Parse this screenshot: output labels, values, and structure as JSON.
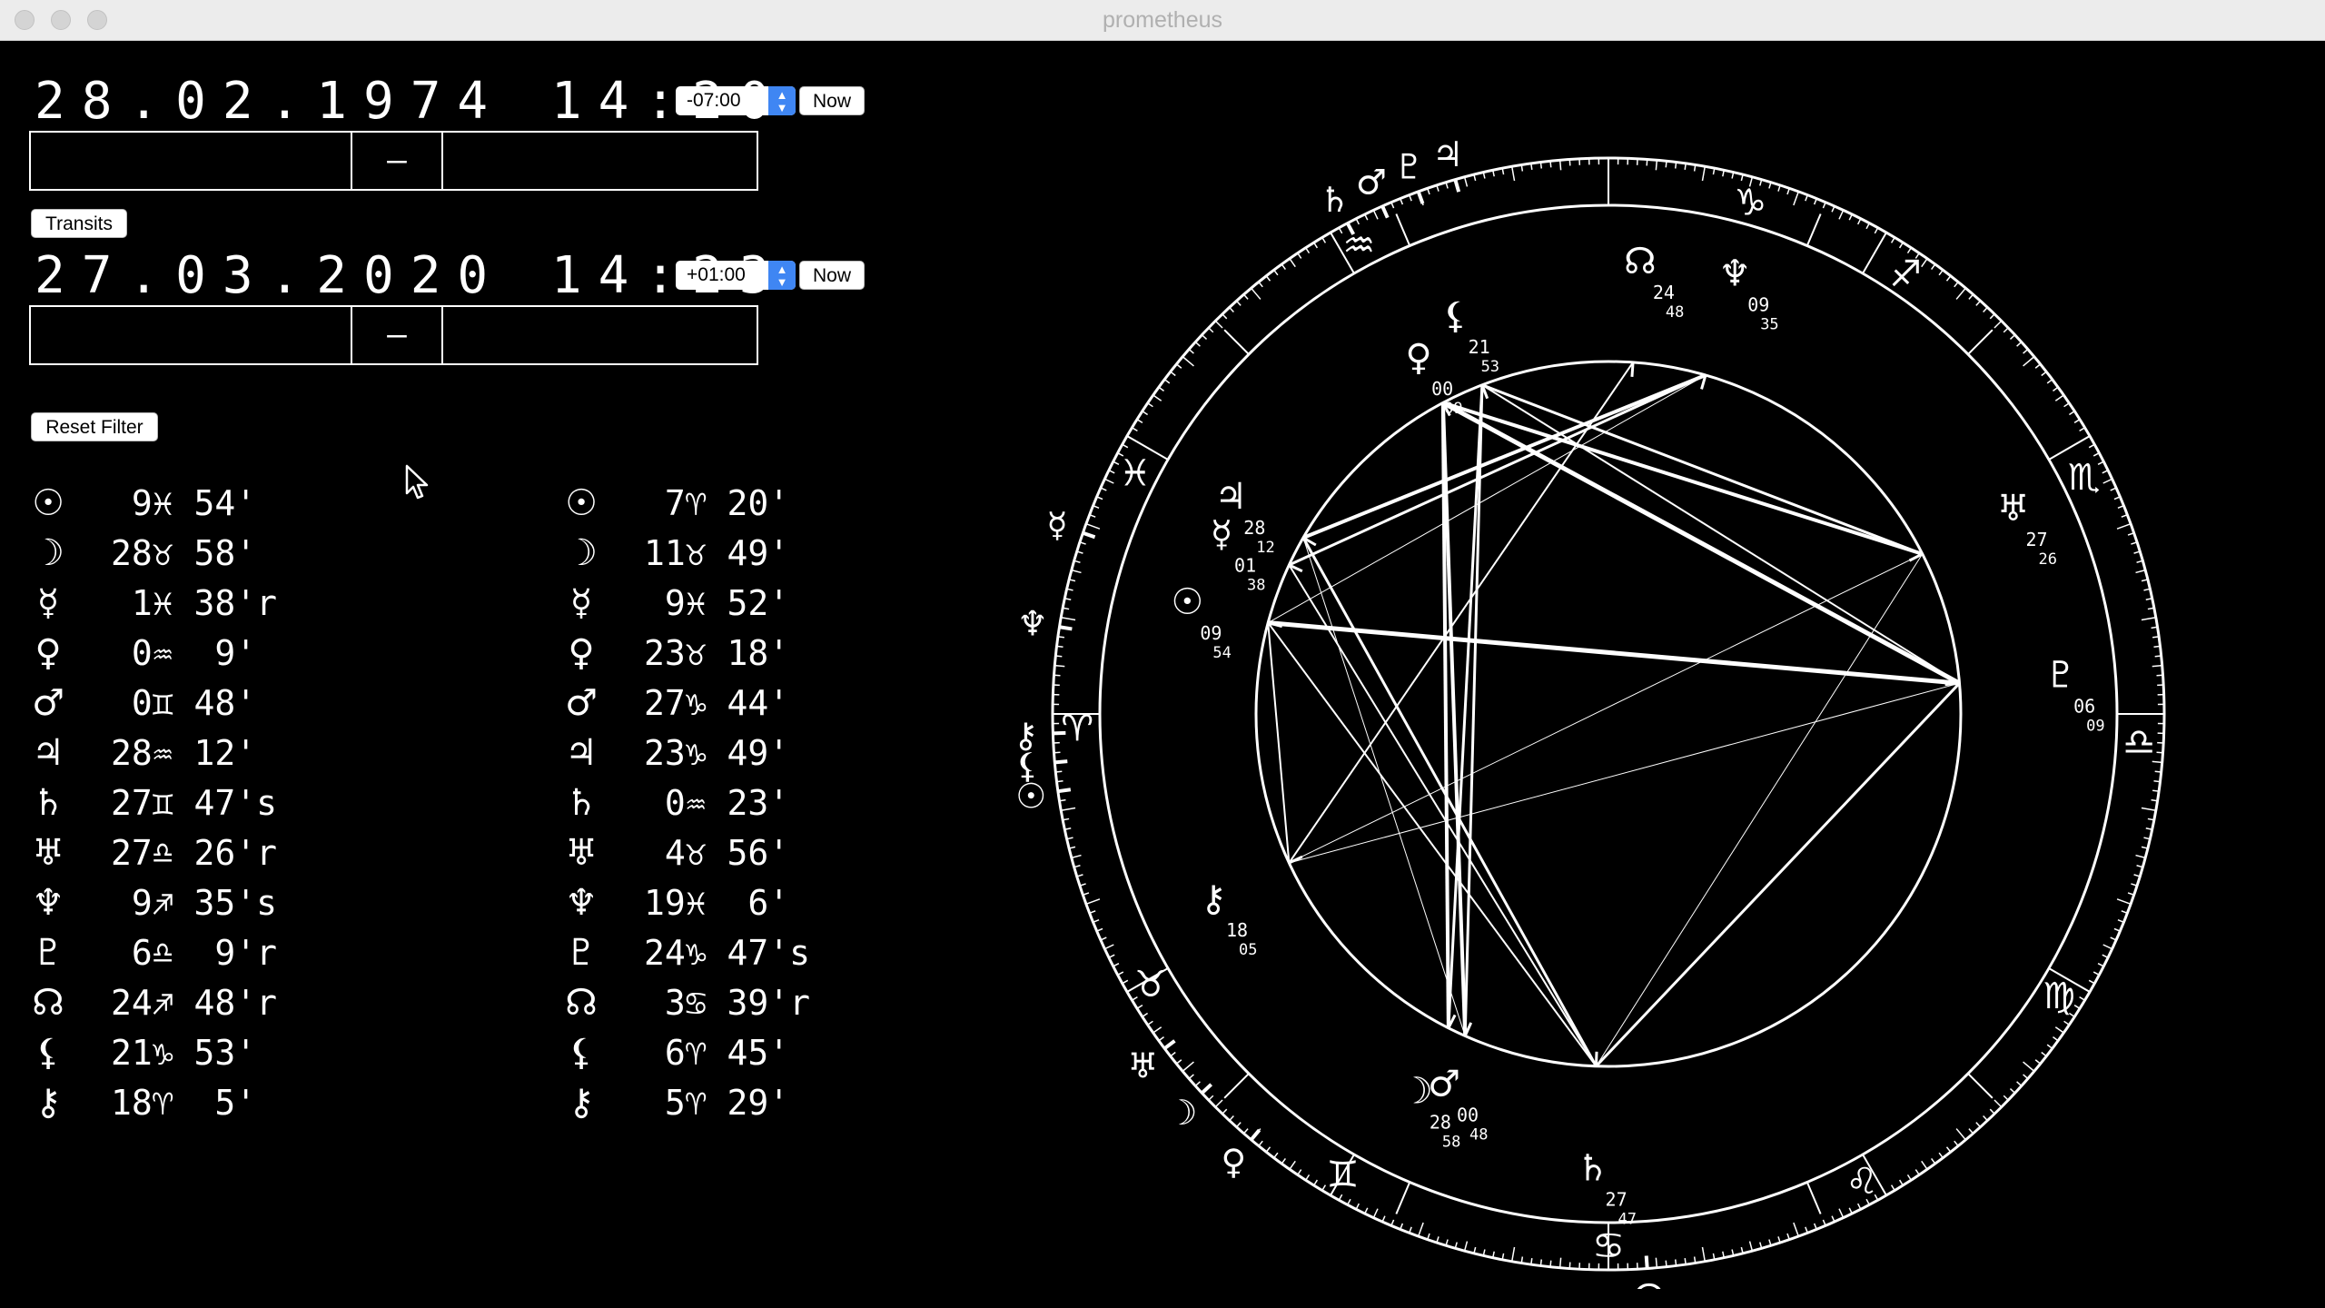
{
  "window": {
    "title": "prometheus"
  },
  "natal": {
    "datetime": "28.02.1974 14:20",
    "timezone": "-07:00",
    "now_label": "Now",
    "location_separator": "–"
  },
  "transits_label": "Transits",
  "transit": {
    "datetime": "27.03.2020 14:23",
    "timezone": "+01:00",
    "now_label": "Now",
    "location_separator": "–"
  },
  "reset_filter_label": "Reset Filter",
  "icons": {
    "stepper": "stepper-arrows-icon",
    "cursor": "mouse-pointer-icon"
  },
  "natal_positions": [
    {
      "planet": "sun",
      "glyph": "☉",
      "text": " 9♓ 54'"
    },
    {
      "planet": "moon",
      "glyph": "☽",
      "text": "28♉ 58'"
    },
    {
      "planet": "mercury",
      "glyph": "☿",
      "text": " 1♓ 38'r"
    },
    {
      "planet": "venus",
      "glyph": "♀",
      "text": " 0♒  9'"
    },
    {
      "planet": "mars",
      "glyph": "♂",
      "text": " 0♊ 48'"
    },
    {
      "planet": "jupiter",
      "glyph": "♃",
      "text": "28♒ 12'"
    },
    {
      "planet": "saturn",
      "glyph": "♄",
      "text": "27♊ 47's"
    },
    {
      "planet": "uranus",
      "glyph": "♅",
      "text": "27♎ 26'r"
    },
    {
      "planet": "neptune",
      "glyph": "♆",
      "text": " 9♐ 35's"
    },
    {
      "planet": "pluto",
      "glyph": "♇",
      "text": " 6♎  9'r"
    },
    {
      "planet": "node",
      "glyph": "☊",
      "text": "24♐ 48'r"
    },
    {
      "planet": "lilith",
      "glyph": "⚸",
      "text": "21♑ 53'"
    },
    {
      "planet": "chiron",
      "glyph": "⚷",
      "text": "18♈  5'"
    }
  ],
  "transit_positions": [
    {
      "planet": "sun",
      "glyph": "☉",
      "text": " 7♈ 20'"
    },
    {
      "planet": "moon",
      "glyph": "☽",
      "text": "11♉ 49'"
    },
    {
      "planet": "mercury",
      "glyph": "☿",
      "text": " 9♓ 52'"
    },
    {
      "planet": "venus",
      "glyph": "♀",
      "text": "23♉ 18'"
    },
    {
      "planet": "mars",
      "glyph": "♂",
      "text": "27♑ 44'"
    },
    {
      "planet": "jupiter",
      "glyph": "♃",
      "text": "23♑ 49'"
    },
    {
      "planet": "saturn",
      "glyph": "♄",
      "text": " 0♒ 23'"
    },
    {
      "planet": "uranus",
      "glyph": "♅",
      "text": " 4♉ 56'"
    },
    {
      "planet": "neptune",
      "glyph": "♆",
      "text": "19♓  6'"
    },
    {
      "planet": "pluto",
      "glyph": "♇",
      "text": "24♑ 47's"
    },
    {
      "planet": "node",
      "glyph": "☊",
      "text": " 3♋ 39'r"
    },
    {
      "planet": "lilith",
      "glyph": "⚸",
      "text": " 6♈ 45'"
    },
    {
      "planet": "chiron",
      "glyph": "⚷",
      "text": " 5♈ 29'"
    }
  ],
  "wheel": {
    "signs": [
      {
        "name": "capricorn",
        "glyph": "♑",
        "deg": 74.5
      },
      {
        "name": "sagittarius",
        "glyph": "♐",
        "deg": 56
      },
      {
        "name": "scorpio",
        "glyph": "♏",
        "deg": 26.5
      },
      {
        "name": "libra",
        "glyph": "♎",
        "deg": -3
      },
      {
        "name": "virgo",
        "glyph": "♍",
        "deg": -32
      },
      {
        "name": "leo",
        "glyph": "♌",
        "deg": -61.5
      },
      {
        "name": "cancer",
        "glyph": "♋",
        "deg": -90
      },
      {
        "name": "gemini",
        "glyph": "♊",
        "deg": -120
      },
      {
        "name": "taurus",
        "glyph": "♉",
        "deg": -149.5
      },
      {
        "name": "aries",
        "glyph": "♈",
        "deg": -178.5
      },
      {
        "name": "pisces",
        "glyph": "♓",
        "deg": 153
      },
      {
        "name": "aquarius",
        "glyph": "♒",
        "deg": 118
      }
    ],
    "inner_planets": [
      {
        "name": "lilith",
        "glyph": "⚸",
        "deg": 111,
        "r": 470,
        "label": [
          "21",
          "53"
        ]
      },
      {
        "name": "venus",
        "glyph": "♀",
        "deg": 118,
        "r": 445,
        "label": [
          "00",
          "09"
        ]
      },
      {
        "name": "node",
        "glyph": "☊",
        "deg": 86,
        "r": 500,
        "label": [
          "24",
          "48"
        ]
      },
      {
        "name": "neptune",
        "glyph": "♆",
        "deg": 74,
        "r": 505,
        "label": [
          "09",
          "35"
        ]
      },
      {
        "name": "uranus",
        "glyph": "♅",
        "deg": 27,
        "r": 500,
        "label": [
          "27",
          "26"
        ]
      },
      {
        "name": "pluto",
        "glyph": "♇",
        "deg": 5,
        "r": 500,
        "label": [
          "06",
          "09"
        ]
      },
      {
        "name": "jupiter",
        "glyph": "♃",
        "deg": 150,
        "r": 480,
        "label": [
          "28",
          "12"
        ]
      },
      {
        "name": "mercury",
        "glyph": "☿",
        "deg": 155,
        "r": 470,
        "label": [
          "01",
          "38"
        ]
      },
      {
        "name": "sun",
        "glyph": "☉",
        "deg": 165,
        "r": 480,
        "label": [
          "09",
          "54"
        ]
      },
      {
        "name": "chiron",
        "glyph": "⚷",
        "deg": -155,
        "r": 480,
        "label": [
          "18",
          "05"
        ]
      },
      {
        "name": "moon",
        "glyph": "☽",
        "deg": -117,
        "r": 465,
        "label": [
          "28",
          "58"
        ]
      },
      {
        "name": "mars",
        "glyph": "♂",
        "deg": -114,
        "r": 445,
        "label": [
          "00",
          "48"
        ]
      },
      {
        "name": "saturn",
        "glyph": "♄",
        "deg": -92,
        "r": 500,
        "label": [
          "27",
          "47"
        ]
      }
    ],
    "outer_planets": [
      {
        "name": "saturn",
        "glyph": "♄",
        "deg": 118
      },
      {
        "name": "mars",
        "glyph": "♂",
        "deg": 114
      },
      {
        "name": "pluto",
        "glyph": "♇",
        "deg": 110
      },
      {
        "name": "jupiter",
        "glyph": "♃",
        "deg": 106
      },
      {
        "name": "mercury",
        "glyph": "☿",
        "deg": 161
      },
      {
        "name": "neptune",
        "glyph": "♆",
        "deg": 171
      },
      {
        "name": "chiron",
        "glyph": "⚷",
        "deg": 182
      },
      {
        "name": "lilith",
        "glyph": "⚸",
        "deg": 185
      },
      {
        "name": "sun",
        "glyph": "☉",
        "deg": 188
      },
      {
        "name": "uranus",
        "glyph": "♅",
        "deg": -143
      },
      {
        "name": "moon",
        "glyph": "☽",
        "deg": -137
      },
      {
        "name": "venus",
        "glyph": "♀",
        "deg": -130
      },
      {
        "name": "node",
        "glyph": "☊",
        "deg": -86
      }
    ]
  }
}
